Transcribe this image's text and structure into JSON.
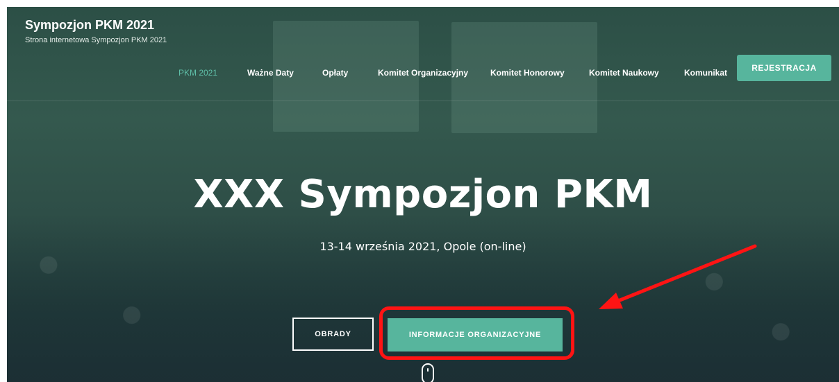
{
  "site": {
    "title": "Sympozjon PKM 2021",
    "tagline": "Strona internetowa Sympozjon PKM 2021"
  },
  "nav": {
    "items": [
      {
        "label": "PKM 2021",
        "active": true
      },
      {
        "label": "Ważne Daty",
        "active": false
      },
      {
        "label": "Opłaty",
        "active": false
      },
      {
        "label": "Komitet Organizacyjny",
        "active": false
      },
      {
        "label": "Komitet Honorowy",
        "active": false
      },
      {
        "label": "Komitet Naukowy",
        "active": false
      },
      {
        "label": "Komunikat",
        "active": false
      }
    ],
    "register_label": "REJESTRACJA"
  },
  "hero": {
    "title": "XXX Sympozjon PKM",
    "subtitle": "13-14 września 2021, Opole (on-line)",
    "buttons": {
      "obrady_label": "OBRADY",
      "info_label": "INFORMACJE ORGANIZACYJNE"
    }
  },
  "colors": {
    "accent": "#57b59d",
    "active_nav": "#5fbfa8",
    "annotation": "#ff1414"
  },
  "icons": {
    "scroll": "mouse-scroll-icon"
  }
}
